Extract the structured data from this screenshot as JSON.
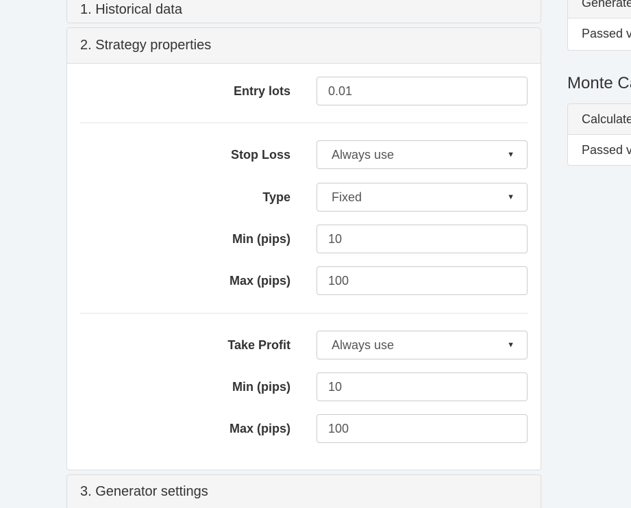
{
  "panels": {
    "historical": {
      "title": "1. Historical data"
    },
    "strategy": {
      "title": "2. Strategy properties",
      "entry_lots": {
        "label": "Entry lots",
        "value": "0.01"
      },
      "stop_loss": {
        "label": "Stop Loss",
        "value": "Always use",
        "type_label": "Type",
        "type_value": "Fixed",
        "min_label": "Min (pips)",
        "min_value": "10",
        "max_label": "Max (pips)",
        "max_value": "100"
      },
      "take_profit": {
        "label": "Take Profit",
        "value": "Always use",
        "min_label": "Min (pips)",
        "min_value": "10",
        "max_label": "Max (pips)",
        "max_value": "100"
      }
    },
    "generator": {
      "title": "3. Generator settings"
    }
  },
  "sidebar": {
    "card1": {
      "row1": "Generated",
      "row2": "Passed v"
    },
    "monte_carlo_title": "Monte Ca",
    "card2": {
      "row1": "Calculated",
      "row2": "Passed v"
    }
  },
  "icons": {
    "dropdown": "caret-down-icon"
  },
  "colors": {
    "background": "#f1f5f8",
    "panel_heading": "#f5f5f5",
    "border": "#dddddd"
  }
}
